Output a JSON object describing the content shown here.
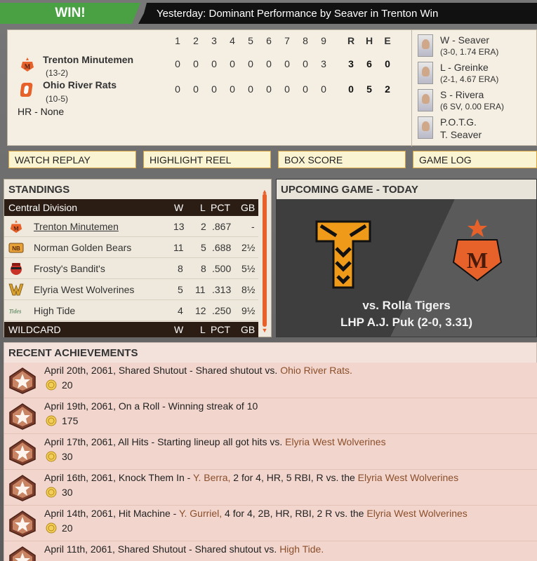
{
  "banner": {
    "result": "WIN!",
    "headline": "Yesterday: Dominant Performance by Seaver in Trenton Win"
  },
  "linescore": {
    "innings": [
      "1",
      "2",
      "3",
      "4",
      "5",
      "6",
      "7",
      "8",
      "9"
    ],
    "totals_headers": [
      "R",
      "H",
      "E"
    ],
    "teams": [
      {
        "name": "Trenton Minutemen",
        "record": "(13-2)",
        "innings": [
          "0",
          "0",
          "0",
          "0",
          "0",
          "0",
          "0",
          "0",
          "3"
        ],
        "r": "3",
        "h": "6",
        "e": "0"
      },
      {
        "name": "Ohio River Rats",
        "record": "(10-5)",
        "innings": [
          "0",
          "0",
          "0",
          "0",
          "0",
          "0",
          "0",
          "0",
          "0"
        ],
        "r": "0",
        "h": "5",
        "e": "2"
      }
    ],
    "hr_line": "HR - None"
  },
  "pitchers": [
    {
      "title": "W - Seaver",
      "sub": "(3-0, 1.74 ERA)"
    },
    {
      "title": "L - Greinke",
      "sub": "(2-1, 4.67 ERA)"
    },
    {
      "title": "S - Rivera",
      "sub": "(6 SV, 0.00 ERA)"
    },
    {
      "title": "P.O.T.G.",
      "sub": "T. Seaver"
    }
  ],
  "buttons": {
    "watch_replay": "WATCH REPLAY",
    "highlight_reel": "HIGHLIGHT REEL",
    "box_score": "BOX SCORE",
    "game_log": "GAME LOG"
  },
  "standings": {
    "title": "STANDINGS",
    "division": "Central Division",
    "headers": {
      "w": "W",
      "l": "L",
      "pct": "PCT",
      "gb": "GB"
    },
    "rows": [
      {
        "team": "Trenton Minutemen",
        "w": "13",
        "l": "2",
        "pct": ".867",
        "gb": "-"
      },
      {
        "team": "Norman Golden Bears",
        "w": "11",
        "l": "5",
        "pct": ".688",
        "gb": "2½"
      },
      {
        "team": "Frosty's Bandit's",
        "w": "8",
        "l": "8",
        "pct": ".500",
        "gb": "5½"
      },
      {
        "team": "Elyria West Wolverines",
        "w": "5",
        "l": "11",
        "pct": ".313",
        "gb": "8½"
      },
      {
        "team": "High Tide",
        "w": "4",
        "l": "12",
        "pct": ".250",
        "gb": "9½"
      }
    ],
    "wildcard": "WILDCARD",
    "icon_labels": {
      "norman": "NB",
      "tide": "Tides"
    }
  },
  "upcoming": {
    "title": "UPCOMING GAME - TODAY",
    "opponent": "vs. Rolla Tigers",
    "pitcher": "LHP A.J. Puk (2-0, 3.31)",
    "home_letter": "M"
  },
  "achievements": {
    "title": "RECENT ACHIEVEMENTS",
    "items": [
      {
        "text": "April 20th, 2061, Shared Shutout - Shared shutout vs. ",
        "link": "Ohio River Rats.",
        "link2": "",
        "mid": "",
        "tail": "",
        "points": "20"
      },
      {
        "text": "April 19th, 2061, On a Roll - Winning streak of 10",
        "link": "",
        "link2": "",
        "mid": "",
        "tail": "",
        "points": "175"
      },
      {
        "text": "April 17th, 2061, All Hits - Starting lineup all got hits vs. ",
        "link": "Elyria West Wolverines",
        "link2": "",
        "mid": "",
        "tail": "",
        "points": "30"
      },
      {
        "text": "April 16th, 2061, Knock Them In - ",
        "link": "Y. Berra,",
        "mid": " 2 for 4, HR, 5 RBI, R vs. the ",
        "link2": "Elyria West Wolverines",
        "tail": "",
        "points": "30"
      },
      {
        "text": "April 14th, 2061, Hit Machine - ",
        "link": "Y. Gurriel,",
        "mid": " 4 for 4, 2B, HR, RBI, 2 R vs. the ",
        "link2": "Elyria West Wolverines",
        "tail": "",
        "points": "20"
      },
      {
        "text": "April 11th, 2061, Shared Shutout - Shared shutout vs. ",
        "link": "High Tide.",
        "link2": "",
        "mid": "",
        "tail": "",
        "points": ""
      }
    ]
  },
  "colors": {
    "win_green": "#4aa143",
    "accent_orange": "#e7622b",
    "dark_brown": "#2b1d13",
    "link_brown": "#8a4e2a"
  }
}
